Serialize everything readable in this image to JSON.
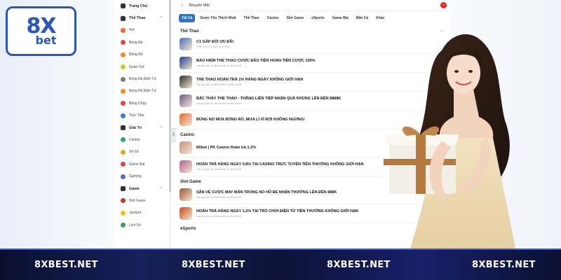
{
  "logo": {
    "line1": "8X",
    "line2": "bet"
  },
  "sidebar": {
    "items": [
      {
        "label": "Trang Chủ",
        "type": "section",
        "icon": "home-icon",
        "color": "#333333"
      },
      {
        "label": "Thể Thao",
        "type": "section",
        "icon": "trophy-icon",
        "color": "#333333",
        "chevron": "⌃"
      },
      {
        "label": "Hot",
        "type": "sub",
        "icon": "fire-icon",
        "color": "#f26b2c"
      },
      {
        "label": "Bóng Đá",
        "type": "sub",
        "icon": "soccer-icon",
        "color": "#e14545"
      },
      {
        "label": "Bóng Rổ",
        "type": "sub",
        "icon": "basketball-icon",
        "color": "#f08a24"
      },
      {
        "label": "Quần Vợt",
        "type": "sub",
        "icon": "tennis-icon",
        "color": "#b7d234"
      },
      {
        "label": "Bóng Đá Điện Tử",
        "type": "sub",
        "icon": "esoccer-icon",
        "color": "#7a7a7a"
      },
      {
        "label": "Bóng Rổ Điện Tử",
        "type": "sub",
        "icon": "ebasketball-icon",
        "color": "#f08a24"
      },
      {
        "label": "Bóng Chày",
        "type": "sub",
        "icon": "baseball-icon",
        "color": "#d94b3b"
      },
      {
        "label": "Trực Tiếp",
        "type": "sub",
        "icon": "live-icon",
        "color": "#3a7bd5"
      },
      {
        "label": "Giải Trí",
        "type": "section",
        "icon": "spade-icon",
        "color": "#333333",
        "chevron": "⌃"
      },
      {
        "label": "Casino",
        "type": "sub",
        "icon": "casino-chip-icon",
        "color": "#2fa36b"
      },
      {
        "label": "Xổ Số",
        "type": "sub",
        "icon": "lottery-icon",
        "color": "#e0a62a"
      },
      {
        "label": "Game Bài",
        "type": "sub",
        "icon": "cards-icon",
        "color": "#d44"
      },
      {
        "label": "Gaming",
        "type": "sub",
        "icon": "gamepad-icon",
        "color": "#5a6ac8"
      },
      {
        "label": "Game",
        "type": "section",
        "icon": "controller-icon",
        "color": "#333333",
        "chevron": "⌃"
      },
      {
        "label": "Slot Game",
        "type": "sub",
        "icon": "slot-icon",
        "color": "#c0392b"
      },
      {
        "label": "Jackpot",
        "type": "sub",
        "icon": "jackpot-icon",
        "color": "#f1c40f"
      },
      {
        "label": "Lịch Sử",
        "type": "sub",
        "icon": "history-icon",
        "color": "#3a9d5d"
      }
    ]
  },
  "main": {
    "title": "Khuyến Mãi",
    "back_icon": "‹",
    "close_icon": "×",
    "tabs": [
      "Tất Cả",
      "Dược Yêu Thích Nhất",
      "Thể Thao",
      "Casino",
      "Slot Game",
      "eSports",
      "Game Bài",
      "Bắn Cá",
      "Khác"
    ],
    "sections": [
      {
        "title": "Thể Thao",
        "items": [
          {
            "title": "C1 GẤP ĐÔI ƯU ĐÃI",
            "sub": "THỂ GIỚI CƯỢNG THƯỞNG",
            "thumb": "#4a6fb3"
          },
          {
            "title": "BẢO HIỂM THỂ THAO CƯỢC ĐẦU TIÊN HOÀN TIỀN CƯỢC 100%",
            "sub": "Các quy tắc và điều khoản và đối xử thể",
            "thumb": "#1d3f8f"
          },
          {
            "title": "THỂ THAO HOÀN TRẢ 1% HÀNG NGÀY KHÔNG GIỚI HẠN",
            "sub": "Các quy tắc và điều khoản và đối xử thể",
            "thumb": "#2d2d2d"
          },
          {
            "title": "BẬC THẦY THỂ THAO - THĂNG LIÊN TIẾP NHẬN QUÀ KHỦNG LÊN ĐẾN 8888K",
            "sub": "Các quy tắc và điều khoản và đối xử thể",
            "thumb": "#6d5a8a"
          },
          {
            "title": "BÙNG NỔ MÙA BÓNG RỔ, MƯA LÌ XÌ RƠI KHÔNG NGỪNG!",
            "sub": "",
            "thumb": "#e06a2e"
          }
        ]
      },
      {
        "title": "Casino",
        "items": [
          {
            "title": "8Xbet | PK Casino Hoàn trả 1.2%",
            "sub": "",
            "thumb": "#c49080"
          },
          {
            "title": "HOÀN TRẢ HÀNG NGÀY 0.8% TẠI CASINO TRỰC TUYẾN TIỀN THƯỞNG KHÔNG GIỚI HẠN",
            "sub": "Các quy tắc và điều khoản và đối xử thể",
            "thumb": "#b06090"
          }
        ]
      },
      {
        "title": "Slot Game",
        "items": [
          {
            "title": "SĂN VÉ CƯỢC MAY MẮN TRONG NỔ HŨ ĐỂ NHẬN THƯỞNG LÊN ĐẾN 888K",
            "sub": "Các quy tắc và điều khoản và đối xử thể",
            "thumb": "#a0522d"
          },
          {
            "title": "HOÀN TRẢ HÀNG NGÀY 1.2% TẠI TRÒ CHƠI ĐIỆN TỬ TIỀN THƯỞNG KHÔNG GIỚI HẠN",
            "sub": "Các quy tắc và điều khoản và đối xử thể",
            "thumb": "#c44a1e"
          }
        ]
      },
      {
        "title": "eSports",
        "items": []
      }
    ]
  },
  "footer": {
    "labels": [
      "8XBEST.NET",
      "8XBEST.NET",
      "8XBEST.NET",
      "8XBEST.NET"
    ]
  },
  "colors": {
    "accent": "#2f74c9",
    "logo": "#2b58b8",
    "close": "#e12424",
    "footer": "#0d1236"
  }
}
